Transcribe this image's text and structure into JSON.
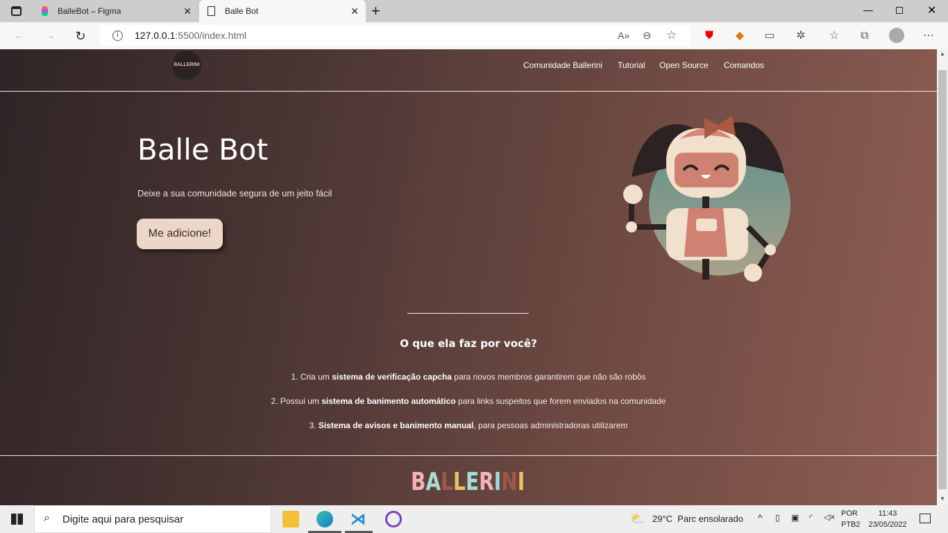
{
  "browser": {
    "tabs": [
      {
        "title": "BalleBot – Figma",
        "icon": "figma-icon"
      },
      {
        "title": "Balle Bot",
        "icon": "document-icon",
        "active": true
      }
    ],
    "url_host": "127.0.0.1",
    "url_rest": ":5500/index.html",
    "window_controls": [
      "minimize",
      "restore",
      "close"
    ]
  },
  "site": {
    "nav": {
      "logo_text": "BALLERINI",
      "links": [
        "Comunidade Ballerini",
        "Tutorial",
        "Open Source",
        "Comandos"
      ]
    },
    "hero": {
      "title": "Balle Bot",
      "subtitle": "Deixe a sua comunidade segura de um jeito fácil",
      "button": "Me adicione!"
    },
    "features": {
      "heading": "O que ela faz por você?",
      "items": [
        {
          "pre": "1. Cria um ",
          "bold": "sistema de verificação capcha",
          "post": " para novos membros garantirem que não são robôs"
        },
        {
          "pre": "2. Possui um ",
          "bold": "sistema de banimento automático",
          "post": " para links suspeitos que forem enviados na comunidade"
        },
        {
          "pre": "3. ",
          "bold": "Sistema de avisos e banimento manual",
          "post": ", para pessoas administradoras utilizarem"
        }
      ]
    },
    "footer": {
      "logo_letters": [
        "B",
        "A",
        "L",
        "L",
        "E",
        "R",
        "I",
        "N",
        "I"
      ],
      "logo_colors": [
        "#f5b3b8",
        "#a9dcd2",
        "#a0574a",
        "#eac262",
        "#a0dcd8",
        "#f5b3b8",
        "#a0dcd8",
        "#a0574a",
        "#eac262"
      ]
    }
  },
  "taskbar": {
    "search_placeholder": "Digite aqui para pesquisar",
    "weather": "29°C  Parc ensolarado",
    "lang1": "POR",
    "lang2": "PTB2",
    "time": "11:43",
    "date": "23/05/2022"
  }
}
